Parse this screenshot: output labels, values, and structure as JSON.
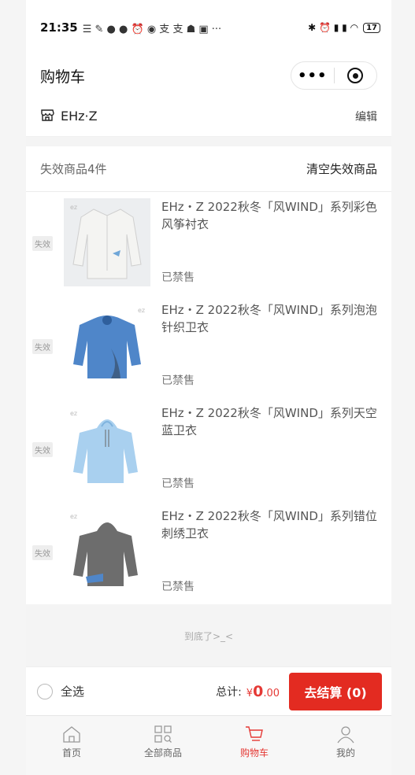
{
  "status_bar": {
    "time": "21:35",
    "icons_text": "☰ ✎ ● ● ⏰ ◉ 支 支 ☗ ▣ ···",
    "right_text": "✱ ⏰ ▮ ▮ ◠",
    "battery": "17"
  },
  "header": {
    "title": "购物车",
    "more": "•••"
  },
  "shop": {
    "name": "EHz·Z",
    "edit": "编辑"
  },
  "invalid": {
    "count_label": "失效商品4件",
    "clear_label": "清空失效商品",
    "items": [
      {
        "tag": "失效",
        "name": "EHz・Z 2022秋冬「风WIND」系列彩色风筝衬衣",
        "status": "已禁售",
        "garment_color": "#e8e8e6",
        "bg": "#eceef0"
      },
      {
        "tag": "失效",
        "name": "EHz・Z 2022秋冬「风WIND」系列泡泡针织卫衣",
        "status": "已禁售",
        "garment_color": "#4f86c9",
        "bg": "#ffffff"
      },
      {
        "tag": "失效",
        "name": "EHz・Z 2022秋冬「风WIND」系列天空蓝卫衣",
        "status": "已禁售",
        "garment_color": "#a9d0ef",
        "bg": "#ffffff"
      },
      {
        "tag": "失效",
        "name": "EHz・Z 2022秋冬「风WIND」系列错位刺绣卫衣",
        "status": "已禁售",
        "garment_color": "#6d6d6d",
        "bg": "#ffffff"
      }
    ]
  },
  "end_tip": "到底了>_<",
  "checkout": {
    "select_all": "全选",
    "total_label": "总计:",
    "currency": "¥",
    "amount": "0",
    "decimals": ".00",
    "button": "去结算 (0)"
  },
  "tabbar": [
    {
      "label": "首页",
      "icon": "home-icon",
      "active": false
    },
    {
      "label": "全部商品",
      "icon": "grid-icon",
      "active": false
    },
    {
      "label": "购物车",
      "icon": "cart-icon",
      "active": true
    },
    {
      "label": "我的",
      "icon": "user-icon",
      "active": false
    }
  ],
  "colors": {
    "accent": "#e32b21",
    "price": "#e53935"
  }
}
